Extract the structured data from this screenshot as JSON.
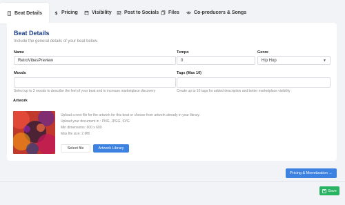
{
  "tabs": [
    {
      "label": "Beat Details",
      "icon": "document-icon"
    },
    {
      "label": "Pricing",
      "icon": "dollar-icon"
    },
    {
      "label": "Visibility",
      "icon": "calendar-icon"
    },
    {
      "label": "Post to Socials",
      "icon": "image-icon"
    },
    {
      "label": "Files",
      "icon": "copy-icon"
    },
    {
      "label": "Co-producers & Songs",
      "icon": "eye-icon"
    }
  ],
  "section": {
    "title": "Beat Details",
    "subtitle": "Include the general details of your beat below."
  },
  "fields": {
    "name": {
      "label": "Name",
      "value": "RetroVibesPreview"
    },
    "tempo": {
      "label": "Tempo",
      "value": "0"
    },
    "genre": {
      "label": "Genre",
      "value": "Hip Hop"
    },
    "moods": {
      "label": "Moods",
      "help": "Select up to 3 moods to describe the feel of your beat and to increase marketplace discovery"
    },
    "tags": {
      "label": "Tags (Max 10)",
      "help": "Create up to 10 tags for added description and better marketplace visibility"
    }
  },
  "artwork": {
    "label": "Artwork",
    "lines": [
      "Upload a new file for the artwork for this beat or choose from artwork already in your library.",
      "Upload your document in : PNG, JPEG, SVG",
      "Min dimensions: 600 x 600",
      "Max file size: 2 MB"
    ],
    "select_label": "Select file",
    "library_label": "Artwork Library"
  },
  "actions": {
    "pricing_label": "Pricing & Monetization →",
    "save_label": "Save"
  }
}
